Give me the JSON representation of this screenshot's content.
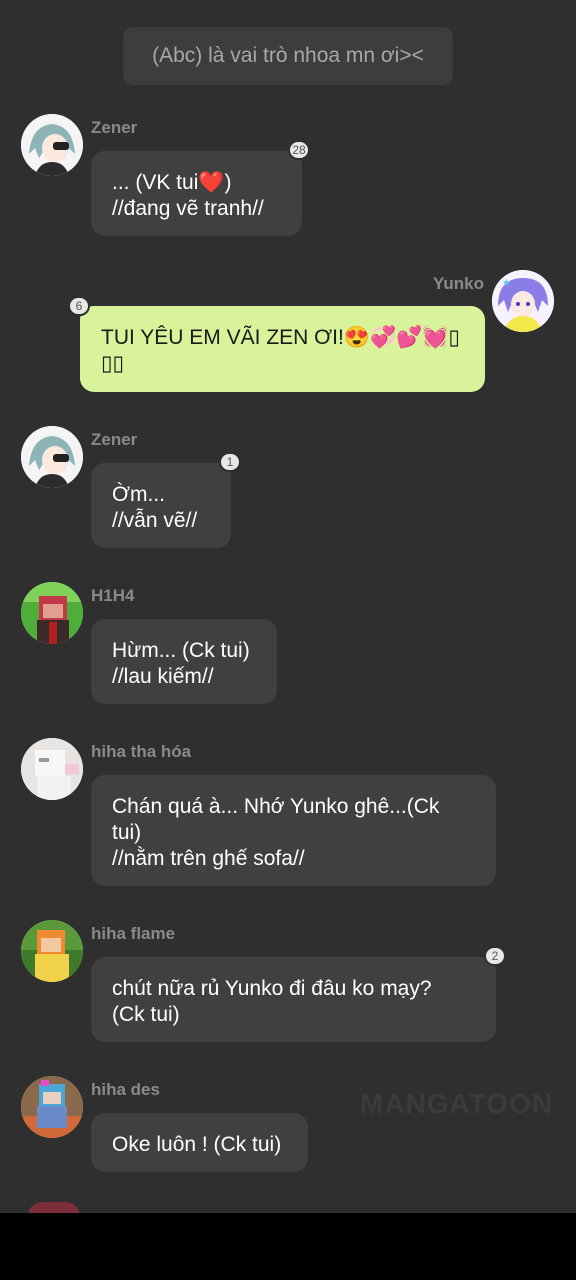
{
  "system_message": "(Abc) là vai trò nhoa mn ơi><",
  "messages": [
    {
      "sender": "Zener",
      "text": "... (VK tui❤️)\n//đang vẽ tranh//",
      "badge": "28"
    },
    {
      "sender": "Yunko",
      "text": "TUI YÊU EM VÃI ZEN ƠI!😍💞💕💓▯\n▯▯",
      "badge": "6"
    },
    {
      "sender": "Zener",
      "text": "Ờm...\n//vẫn vẽ//",
      "badge": "1"
    },
    {
      "sender": "H1H4",
      "text": "Hừm... (Ck tui)\n//lau kiếm//"
    },
    {
      "sender": "hiha tha hóa",
      "text": "Chán quá à... Nhớ Yunko ghê...(Ck\ntui)\n//nằm trên ghế sofa//"
    },
    {
      "sender": "hiha flame",
      "text": "chút nữa rủ Yunko đi đâu ko mạy?\n(Ck tui)",
      "badge": "2"
    },
    {
      "sender": "hiha des",
      "text": "Oke luôn ! (Ck tui)"
    }
  ],
  "watermark": "MANGATOON",
  "colors": {
    "background": "#2f2f2f",
    "bubble": "#404040",
    "my_bubble": "#d9f39a",
    "name": "#8a8a8a"
  }
}
